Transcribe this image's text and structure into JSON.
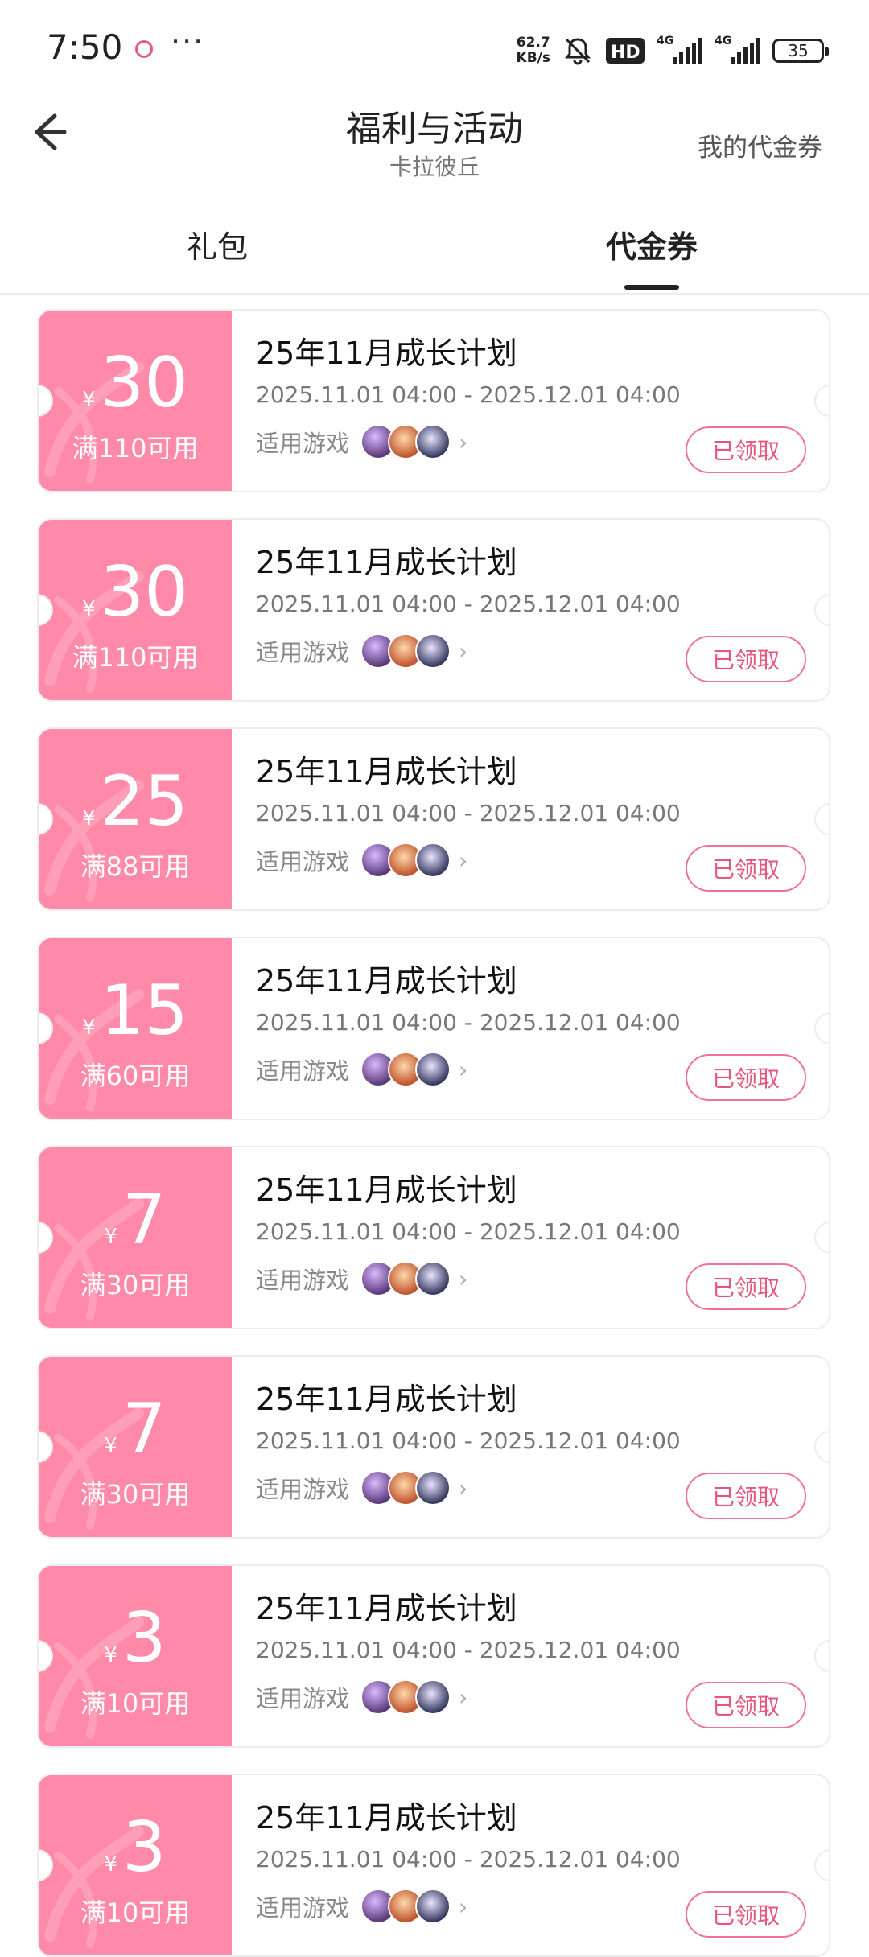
{
  "status_bar": {
    "time": "7:50",
    "more": "···",
    "net_speed_value": "62.7",
    "net_speed_unit": "KB/s",
    "battery": "35"
  },
  "header": {
    "title": "福利与活动",
    "subtitle": "卡拉彼丘",
    "my_coupons": "我的代金券"
  },
  "tabs": [
    {
      "label": "礼包",
      "active": false
    },
    {
      "label": "代金券",
      "active": true
    }
  ],
  "colors": {
    "coupon_bg": "#ff89a8",
    "accent": "#e5577d"
  },
  "coupons": [
    {
      "amount": "30",
      "currency": "¥",
      "condition": "满110可用",
      "title": "25年11月成长计划",
      "date": "2025.11.01 04:00 - 2025.12.01 04:00",
      "games_label": "适用游戏",
      "button": "已领取"
    },
    {
      "amount": "30",
      "currency": "¥",
      "condition": "满110可用",
      "title": "25年11月成长计划",
      "date": "2025.11.01 04:00 - 2025.12.01 04:00",
      "games_label": "适用游戏",
      "button": "已领取"
    },
    {
      "amount": "25",
      "currency": "¥",
      "condition": "满88可用",
      "title": "25年11月成长计划",
      "date": "2025.11.01 04:00 - 2025.12.01 04:00",
      "games_label": "适用游戏",
      "button": "已领取"
    },
    {
      "amount": "15",
      "currency": "¥",
      "condition": "满60可用",
      "title": "25年11月成长计划",
      "date": "2025.11.01 04:00 - 2025.12.01 04:00",
      "games_label": "适用游戏",
      "button": "已领取"
    },
    {
      "amount": "7",
      "currency": "¥",
      "condition": "满30可用",
      "title": "25年11月成长计划",
      "date": "2025.11.01 04:00 - 2025.12.01 04:00",
      "games_label": "适用游戏",
      "button": "已领取"
    },
    {
      "amount": "7",
      "currency": "¥",
      "condition": "满30可用",
      "title": "25年11月成长计划",
      "date": "2025.11.01 04:00 - 2025.12.01 04:00",
      "games_label": "适用游戏",
      "button": "已领取"
    },
    {
      "amount": "3",
      "currency": "¥",
      "condition": "满10可用",
      "title": "25年11月成长计划",
      "date": "2025.11.01 04:00 - 2025.12.01 04:00",
      "games_label": "适用游戏",
      "button": "已领取"
    },
    {
      "amount": "3",
      "currency": "¥",
      "condition": "满10可用",
      "title": "25年11月成长计划",
      "date": "2025.11.01 04:00 - 2025.12.01 04:00",
      "games_label": "适用游戏",
      "button": "已领取"
    }
  ]
}
